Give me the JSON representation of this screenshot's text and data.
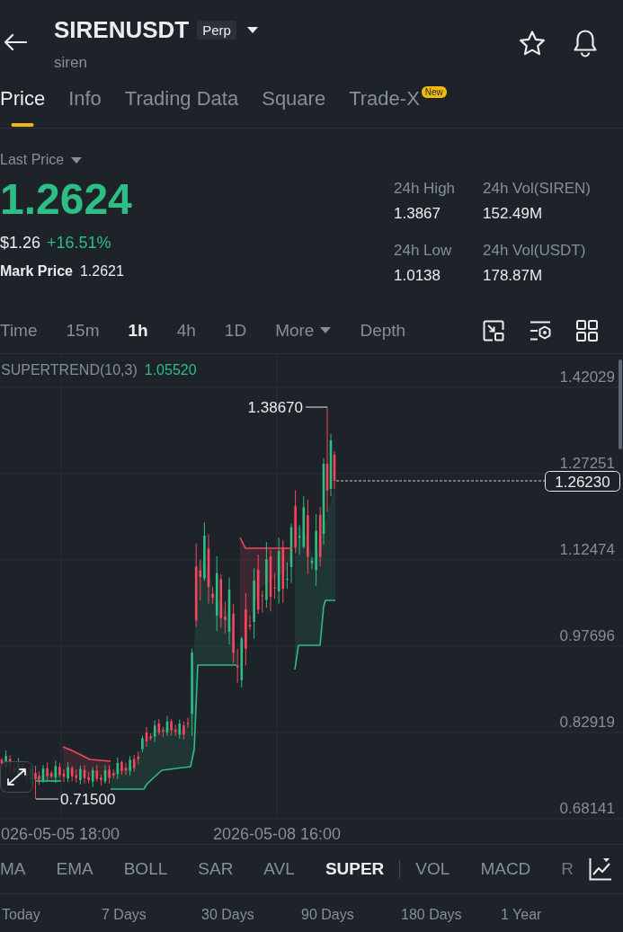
{
  "header": {
    "title": "SIRENUSDT",
    "badge": "Perp",
    "subtitle": "siren"
  },
  "tabs": [
    {
      "label": "Price",
      "selected": true
    },
    {
      "label": "Info",
      "selected": false
    },
    {
      "label": "Trading Data",
      "selected": false
    },
    {
      "label": "Square",
      "selected": false
    },
    {
      "label": "Trade-X",
      "selected": false,
      "badge": "New"
    }
  ],
  "price": {
    "label": "Last Price",
    "value": "1.2624",
    "usd_value": "$1.26",
    "change": "+16.51%",
    "mark_label": "Mark Price",
    "mark_value": "1.2621"
  },
  "stats": [
    {
      "label": "24h High",
      "value": "1.3867"
    },
    {
      "label": "24h Vol(SIREN)",
      "value": "152.49M"
    },
    {
      "label": "24h Low",
      "value": "1.0138"
    },
    {
      "label": "24h Vol(USDT)",
      "value": "178.87M"
    }
  ],
  "intervals": [
    {
      "label": "Time",
      "kind": "option",
      "selected": false
    },
    {
      "label": "15m",
      "kind": "option",
      "selected": false
    },
    {
      "label": "1h",
      "kind": "option",
      "selected": true
    },
    {
      "label": "4h",
      "kind": "option",
      "selected": false
    },
    {
      "label": "1D",
      "kind": "option",
      "selected": false
    },
    {
      "label": "More",
      "kind": "menu",
      "selected": false
    },
    {
      "label": "Depth",
      "kind": "option",
      "selected": false
    }
  ],
  "chart": {
    "indicator": "SUPERTREND(10,3)",
    "indicator_value": "1.05520",
    "y_labels": [
      "1.42029",
      "1.27251",
      "1.12474",
      "0.97696",
      "0.82919",
      "0.68141"
    ],
    "x_labels": [
      "026-05-05 18:00",
      "2026-05-08 16:00"
    ],
    "high_label": "1.38670",
    "low_label": "0.71500",
    "last_price": "1.26230"
  },
  "indicators": {
    "main": [
      {
        "label": "MA",
        "selected": false
      },
      {
        "label": "EMA",
        "selected": false
      },
      {
        "label": "BOLL",
        "selected": false
      },
      {
        "label": "SAR",
        "selected": false
      },
      {
        "label": "AVL",
        "selected": false
      },
      {
        "label": "SUPER",
        "selected": true
      }
    ],
    "sub": [
      {
        "label": "VOL",
        "selected": false
      },
      {
        "label": "MACD",
        "selected": false
      },
      {
        "label": "R",
        "selected": false
      }
    ]
  },
  "periods": [
    "Today",
    "7 Days",
    "30 Days",
    "90 Days",
    "180 Days",
    "1 Year"
  ]
}
